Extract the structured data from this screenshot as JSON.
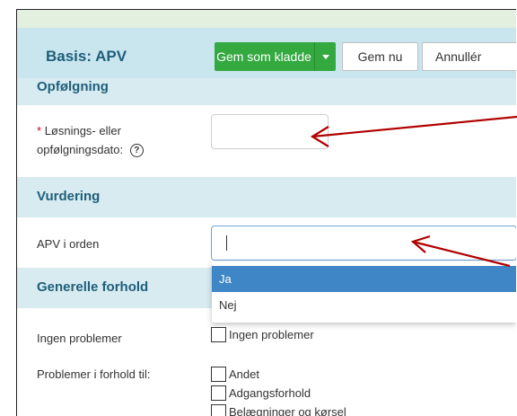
{
  "header": {
    "title": "Basis: APV",
    "save_draft_label": "Gem som kladde",
    "save_now_label": "Gem nu",
    "cancel_label": "Annullér"
  },
  "sections": {
    "followup": {
      "title": "Opfølgning",
      "required_marker": "*",
      "date_label_line1": "Løsnings- eller",
      "date_label_line2": "opfølgningsdato:",
      "help_icon": "?"
    },
    "assessment": {
      "title": "Vurdering",
      "apv_label": "APV i orden",
      "options": [
        "Ja",
        "Nej"
      ],
      "highlighted_option": "Ja"
    },
    "general": {
      "title": "Generelle forhold",
      "no_problems_label": "Ingen problemer",
      "no_problems_checkbox": "Ingen problemer",
      "problems_label": "Problemer i forhold til:",
      "problem_options": [
        "Andet",
        "Adgangsforhold",
        "Belægninger og kørsel"
      ]
    }
  },
  "colors": {
    "accent_green": "#33a93f",
    "section_bg": "#d7ebf1",
    "arrow": "#b00000",
    "highlight": "#3f86c6"
  }
}
